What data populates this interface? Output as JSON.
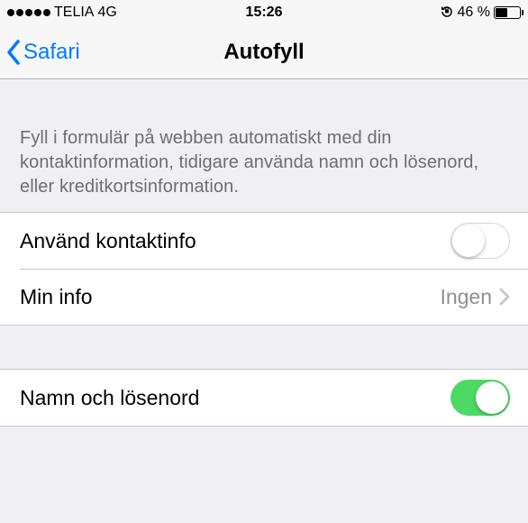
{
  "status": {
    "carrier": "TELIA",
    "network": "4G",
    "time": "15:26",
    "battery_pct": "46 %"
  },
  "nav": {
    "back_label": "Safari",
    "title": "Autofyll"
  },
  "section_desc": "Fyll i formulär på webben automatiskt med din kontaktinformation, tidigare använda namn och lösenord, eller kreditkortsinformation.",
  "rows": {
    "use_contact": {
      "label": "Använd kontaktinfo",
      "on": false
    },
    "my_info": {
      "label": "Min info",
      "value": "Ingen"
    },
    "names_passwords": {
      "label": "Namn och lösenord",
      "on": true
    }
  }
}
